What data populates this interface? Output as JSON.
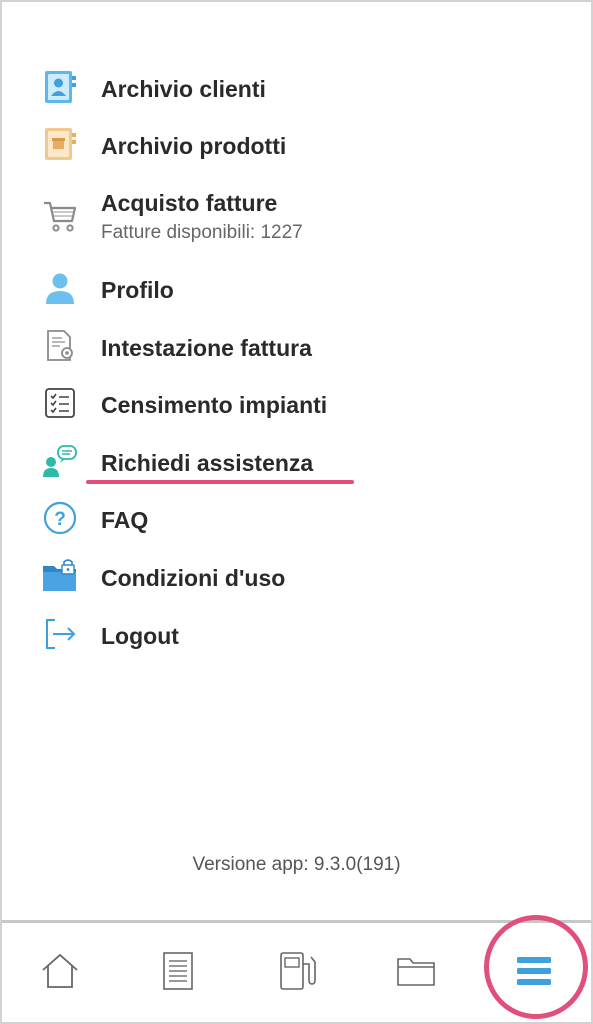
{
  "menu": {
    "items": [
      {
        "label": "Archivio clienti",
        "icon": "contacts-book-icon"
      },
      {
        "label": "Archivio prodotti",
        "icon": "products-book-icon"
      },
      {
        "label": "Acquisto fatture",
        "sublabel": "Fatture disponibili: 1227",
        "icon": "shopping-cart-icon"
      },
      {
        "label": "Profilo",
        "icon": "user-profile-icon"
      },
      {
        "label": "Intestazione fattura",
        "icon": "document-settings-icon"
      },
      {
        "label": "Censimento impianti",
        "icon": "checklist-icon"
      },
      {
        "label": "Richiedi assistenza",
        "icon": "support-chat-icon"
      },
      {
        "label": "FAQ",
        "icon": "question-circle-icon"
      },
      {
        "label": "Condizioni d'uso",
        "icon": "locked-folder-icon"
      },
      {
        "label": "Logout",
        "icon": "logout-arrow-icon"
      }
    ]
  },
  "footer": {
    "version": "Versione app: 9.3.0(191)"
  },
  "bottom_nav": [
    {
      "icon": "home-icon"
    },
    {
      "icon": "document-list-icon"
    },
    {
      "icon": "fuel-pump-icon"
    },
    {
      "icon": "folder-icon"
    },
    {
      "icon": "menu-hamburger-icon",
      "active": true
    }
  ],
  "colors": {
    "accent_icon": "#3ea0dd",
    "highlight": "#e0507a",
    "icon_gray": "#707070"
  }
}
